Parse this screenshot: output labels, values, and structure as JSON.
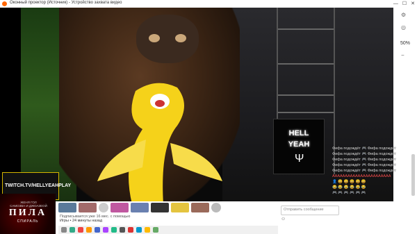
{
  "window": {
    "title": "Оконный проектор (Источник) - Устройство захвата видео",
    "minimize": "—",
    "maximize": "☐",
    "close": "✕"
  },
  "overlay": {
    "twitch_url": "TWITCH.TV/HELLYEAHPLAY",
    "neon_line1": "HELL",
    "neon_line2": "YEAH"
  },
  "browser_side": {
    "zoom": "50%"
  },
  "chat": {
    "rows": [
      "Фифа подождёт 🎮 Фифа подождёт",
      "Фифа подождёт 🎮 Фифа подождёт",
      "Фифа подождёт 🎮 Фифа подождёт",
      "Фифа подождёт 🎮 Фифа подождёт",
      "Фифа подождёт 🎮 Фифа подождёт",
      "AAAAAAAAAAAAAAAAAAAAAAA",
      "👤 😄 😄 😄 😄 😄",
      "😂 😂 😂 😂 😂 😂",
      "🎮 🎮 🎮 🎮 🎮 🎮"
    ]
  },
  "poster": {
    "caption": "ЖЕНЯ ГОЛ\nСАМОЗВА И ДЖОАЗЕОЙ",
    "title": "ПИЛА",
    "subtitle": "СПИРАЛЬ"
  },
  "bottom": {
    "status1": "Подписывается уже 16 мес. с помощью",
    "status2": "Игры • 24 минуты назад",
    "message_placeholder": "Отправить сообщение"
  }
}
